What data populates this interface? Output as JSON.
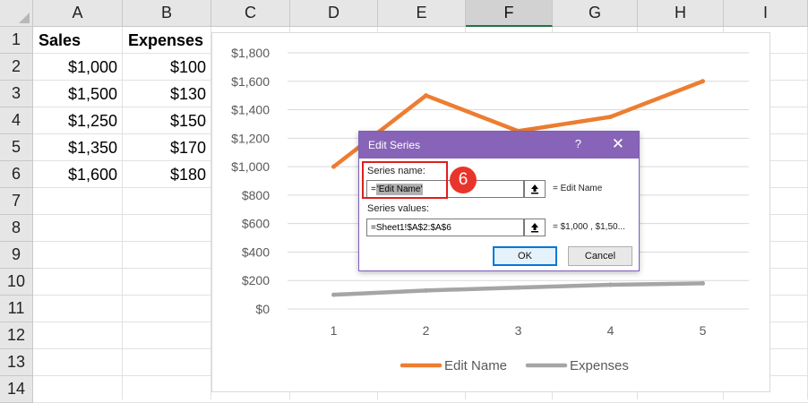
{
  "spreadsheet": {
    "columns": [
      "A",
      "B",
      "C",
      "D",
      "E",
      "F",
      "G",
      "H",
      "I"
    ],
    "selected_column": "F",
    "rows": [
      "1",
      "2",
      "3",
      "4",
      "5",
      "6",
      "7",
      "8",
      "9",
      "10",
      "11",
      "12",
      "13",
      "14"
    ],
    "header_row": {
      "a": "Sales",
      "b": "Expenses"
    },
    "data_rows": [
      {
        "a": "$1,000",
        "b": "$100"
      },
      {
        "a": "$1,500",
        "b": "$130"
      },
      {
        "a": "$1,250",
        "b": "$150"
      },
      {
        "a": "$1,350",
        "b": "$170"
      },
      {
        "a": "$1,600",
        "b": "$180"
      }
    ]
  },
  "chart_data": {
    "type": "line",
    "x": [
      1,
      2,
      3,
      4,
      5
    ],
    "categories": [
      "1",
      "2",
      "3",
      "4",
      "5"
    ],
    "series": [
      {
        "name": "Edit Name",
        "values": [
          1000,
          1500,
          1250,
          1350,
          1600
        ],
        "color": "#ed7d31"
      },
      {
        "name": "Expenses",
        "values": [
          100,
          130,
          150,
          170,
          180
        ],
        "color": "#a5a5a5"
      }
    ],
    "ylim": [
      0,
      1800
    ],
    "y_ticks": [
      "$0",
      "$200",
      "$400",
      "$600",
      "$800",
      "$1,000",
      "$1,200",
      "$1,400",
      "$1,600",
      "$1,800"
    ],
    "title": "",
    "xlabel": "",
    "ylabel": "",
    "grid": true,
    "legend_position": "bottom"
  },
  "dialog": {
    "title": "Edit Series",
    "help": "?",
    "close": "✕",
    "series_name_label": "Series name:",
    "series_name_prefix": "=",
    "series_name_value": "'Edit Name'",
    "series_name_preview": "= Edit Name",
    "series_values_label": "Series values:",
    "series_values_value": "=Sheet1!$A$2:$A$6",
    "series_values_preview": "= $1,000 , $1,50...",
    "ok_label": "OK",
    "cancel_label": "Cancel"
  },
  "annotation": {
    "step": "6",
    "color": "#e01e1e"
  }
}
